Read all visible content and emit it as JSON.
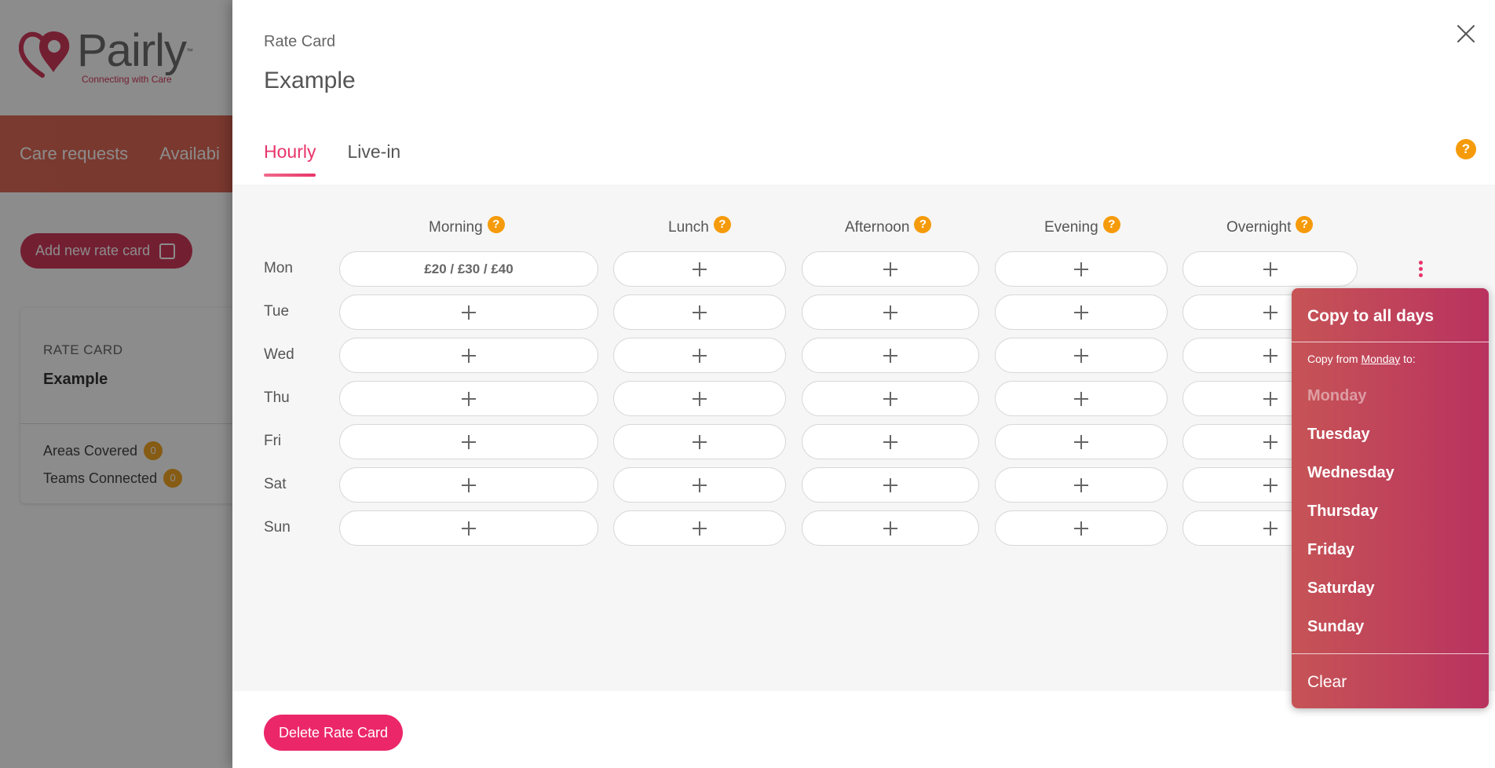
{
  "background": {
    "logo": {
      "name": "Pairly",
      "tm": "™",
      "tagline": "Connecting with Care"
    },
    "nav": [
      "Care requests",
      "Availabi"
    ],
    "add_button": "Add new rate card",
    "card": {
      "label": "RATE CARD",
      "title": "Example",
      "areas_label": "Areas Covered",
      "areas_count": "0",
      "teams_label": "Teams Connected",
      "teams_count": "0"
    }
  },
  "modal": {
    "label": "Rate Card",
    "title": "Example",
    "tabs": [
      "Hourly",
      "Live-in"
    ],
    "active_tab": "Hourly",
    "help_glyph": "?",
    "columns": [
      "Morning",
      "Lunch",
      "Afternoon",
      "Evening",
      "Overnight"
    ],
    "rows": [
      {
        "day": "Mon",
        "cells": [
          "£20 / £30 / £40",
          "+",
          "+",
          "+",
          "+"
        ]
      },
      {
        "day": "Tue",
        "cells": [
          "+",
          "+",
          "+",
          "+",
          "+"
        ]
      },
      {
        "day": "Wed",
        "cells": [
          "+",
          "+",
          "+",
          "+",
          "+"
        ]
      },
      {
        "day": "Thu",
        "cells": [
          "+",
          "+",
          "+",
          "+",
          "+"
        ]
      },
      {
        "day": "Fri",
        "cells": [
          "+",
          "+",
          "+",
          "+",
          "+"
        ]
      },
      {
        "day": "Sat",
        "cells": [
          "+",
          "+",
          "+",
          "+",
          "+"
        ]
      },
      {
        "day": "Sun",
        "cells": [
          "+",
          "+",
          "+",
          "+",
          "+"
        ]
      }
    ],
    "delete_button": "Delete Rate Card"
  },
  "menu": {
    "copy_all": "Copy to all days",
    "copy_from_prefix": "Copy from",
    "copy_from_day": "Monday",
    "copy_from_suffix": "to:",
    "days": [
      {
        "label": "Monday",
        "disabled": true
      },
      {
        "label": "Tuesday",
        "disabled": false
      },
      {
        "label": "Wednesday",
        "disabled": false
      },
      {
        "label": "Thursday",
        "disabled": false
      },
      {
        "label": "Friday",
        "disabled": false
      },
      {
        "label": "Saturday",
        "disabled": false
      },
      {
        "label": "Sunday",
        "disabled": false
      }
    ],
    "clear": "Clear"
  },
  "colors": {
    "accent": "#e8346a",
    "help": "#f59b0b",
    "menu_start": "#c65456",
    "menu_end": "#b9325f",
    "nav": "#d4544f"
  }
}
